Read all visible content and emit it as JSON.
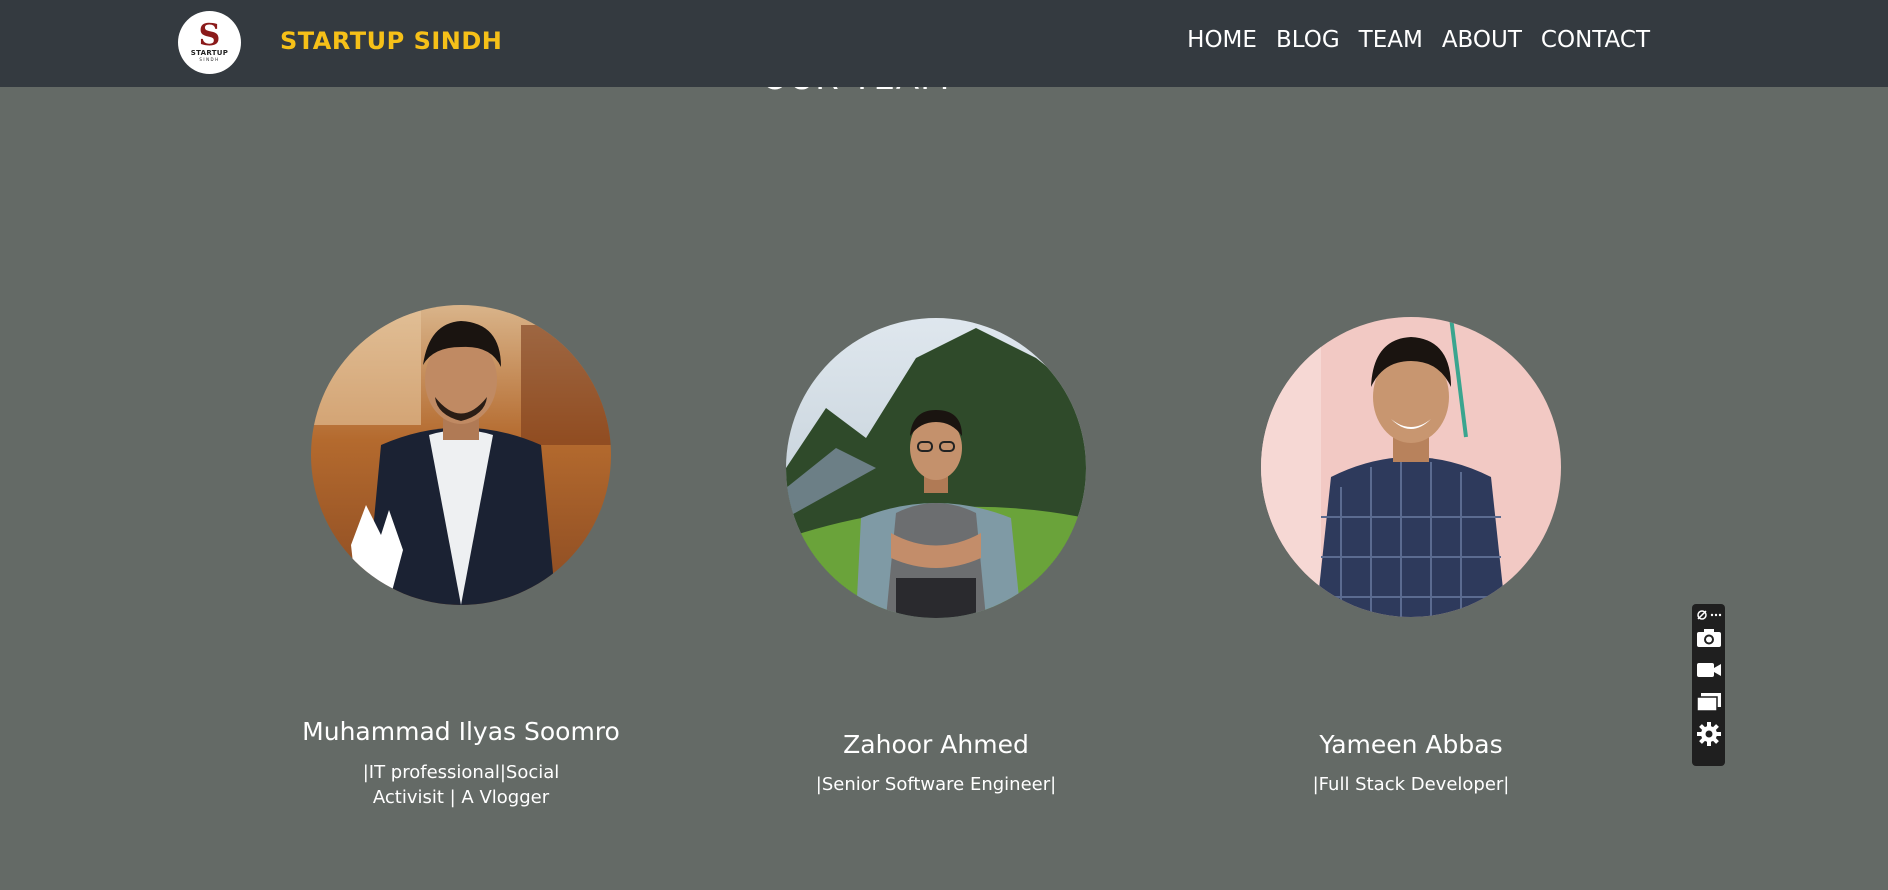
{
  "section": {
    "title": "OUR TEAM"
  },
  "nav": {
    "logo": {
      "line1": "STARTUP",
      "line2": "SINDH"
    },
    "brand": "STARTUP SINDH",
    "links": [
      "HOME",
      "BLOG",
      "TEAM",
      "ABOUT",
      "CONTACT"
    ]
  },
  "team": [
    {
      "name": "Muhammad Ilyas Soomro",
      "role": "|IT professional|Social Activisit | A Vlogger"
    },
    {
      "name": "Zahoor Ahmed",
      "role": "|Senior Software Engineer|"
    },
    {
      "name": "Yameen Abbas",
      "role": "|Full Stack Developer|"
    }
  ],
  "toolbar": {
    "icons": [
      "pin-icon",
      "more-icon",
      "camera-icon",
      "video-icon",
      "windows-icon",
      "gear-icon"
    ]
  },
  "colors": {
    "background": "#646a66",
    "navbar": "#343a40",
    "brand": "#f6c018",
    "text": "#ffffff"
  }
}
